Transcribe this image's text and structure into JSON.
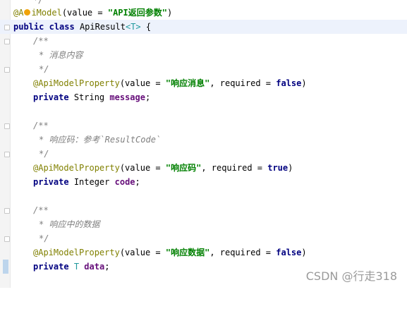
{
  "editor": {
    "lines": {
      "l0": {
        "text": "*/"
      },
      "l1": {
        "a": "@A",
        "b": "iModel",
        "c": "(value = ",
        "d": "\"API返回参数\"",
        "e": ")"
      },
      "l2": {
        "kw1": "public",
        "kw2": "class",
        "cls": "ApiResult",
        "tp": "<T>",
        "rest": " {"
      },
      "l3": {
        "text": "/**"
      },
      "l4": {
        "text": "* 消息内容"
      },
      "l5": {
        "text": "*/"
      },
      "l6": {
        "ann": "@ApiModelProperty",
        "p1": "(value = ",
        "s": "\"响应消息\"",
        "p2": ", required = ",
        "v": "false",
        "p3": ")"
      },
      "l7": {
        "kw": "private",
        "type": "String",
        "fld": "message",
        "end": ";"
      },
      "l9": {
        "text": "/**"
      },
      "l10": {
        "text": "* 响应码：参考`ResultCode`"
      },
      "l11": {
        "text": "*/"
      },
      "l12": {
        "ann": "@ApiModelProperty",
        "p1": "(value = ",
        "s": "\"响应码\"",
        "p2": ", required = ",
        "v": "true",
        "p3": ")"
      },
      "l13": {
        "kw": "private",
        "type": "Integer",
        "fld": "code",
        "end": ";"
      },
      "l15": {
        "text": "/**"
      },
      "l16": {
        "text": "* 响应中的数据"
      },
      "l17": {
        "text": "*/"
      },
      "l18": {
        "ann": "@ApiModelProperty",
        "p1": "(value = ",
        "s": "\"响应数据\"",
        "p2": ", required = ",
        "v": "false",
        "p3": ")"
      },
      "l19": {
        "kw": "private",
        "type": "T",
        "fld": "data",
        "end": ";"
      }
    }
  },
  "watermark": "CSDN @行走318",
  "colors": {
    "keyword": "#000080",
    "annotation": "#808000",
    "string": "#008000",
    "comment": "#808080",
    "field": "#660e7a",
    "type_param": "#20999d",
    "caret_line": "#edf2fc"
  },
  "icons": {
    "intention_bulb": "lightbulb-icon"
  }
}
